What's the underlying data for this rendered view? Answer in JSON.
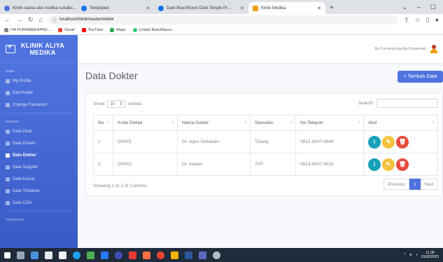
{
  "browser": {
    "tabs": [
      {
        "label": "Klinik utama alia medika sukabu...",
        "color": "#4e73df"
      },
      {
        "label": "Templated",
        "color": "#1a73e8"
      },
      {
        "label": "Dark Blue Brown Dark Simple Pr...",
        "color": "#1a73e8"
      },
      {
        "label": "Klinik Medika",
        "color": "#f39c12"
      }
    ],
    "new_tab": "+",
    "url": "localhost/Klinik/master/dokter",
    "bookmarks": [
      {
        "label": "ITA PURNAMA APRIL...",
        "color": "#888"
      },
      {
        "label": "Gmail",
        "color": "#ea4335"
      },
      {
        "label": "YouTube",
        "color": "#ff0000"
      },
      {
        "label": "Maps",
        "color": "#34a853"
      },
      {
        "label": "Unduh BukuWarun...",
        "color": "#2ecc71"
      }
    ]
  },
  "sidebar": {
    "brand_line1": "KLINIK ALIYA",
    "brand_line2": "MEDIKA",
    "section_user": "USER",
    "user_items": [
      "My Profile",
      "Edit Profile",
      "Change Password"
    ],
    "section_master": "MASTER",
    "master_items": [
      "Data Obat",
      "Data Pasien",
      "Data Dokter",
      "Data Supplier",
      "Data Kamar",
      "Data Tindakan",
      "Data COA"
    ],
    "section_transaksi": "TRANSAKSI"
  },
  "topbar": {
    "username": "Ita Purnama Aprilia Nurjannah"
  },
  "page": {
    "title": "Data Dokter",
    "add_button": "+ Tambah Data"
  },
  "table_controls": {
    "show": "Show",
    "entries_value": "10",
    "entries": "entries",
    "search_label": "Search:"
  },
  "table": {
    "headers": [
      "No",
      "Kode Dokter",
      "Nama Dokter",
      "Spesialis",
      "No Telepon",
      "Aksi"
    ],
    "rows": [
      {
        "no": "1",
        "kode": "DR001",
        "nama": "Dr. Agus Setiawan",
        "spesialis": "Tulang",
        "telepon": "0813-9447-9848"
      },
      {
        "no": "2",
        "kode": "DR002",
        "nama": "Dr. Irawan",
        "spesialis": "THT",
        "telepon": "0813-9447-9833"
      }
    ]
  },
  "footer": {
    "info": "Showing 1 to 2 of 2 entries",
    "prev": "Previous",
    "page": "1",
    "next": "Next"
  },
  "taskbar": {
    "time": "11.38",
    "date": "01/02/2023"
  },
  "colors": {
    "primary": "#4e73df",
    "info": "#17a2b8",
    "warning": "#f6c23e",
    "danger": "#e74a3b"
  }
}
